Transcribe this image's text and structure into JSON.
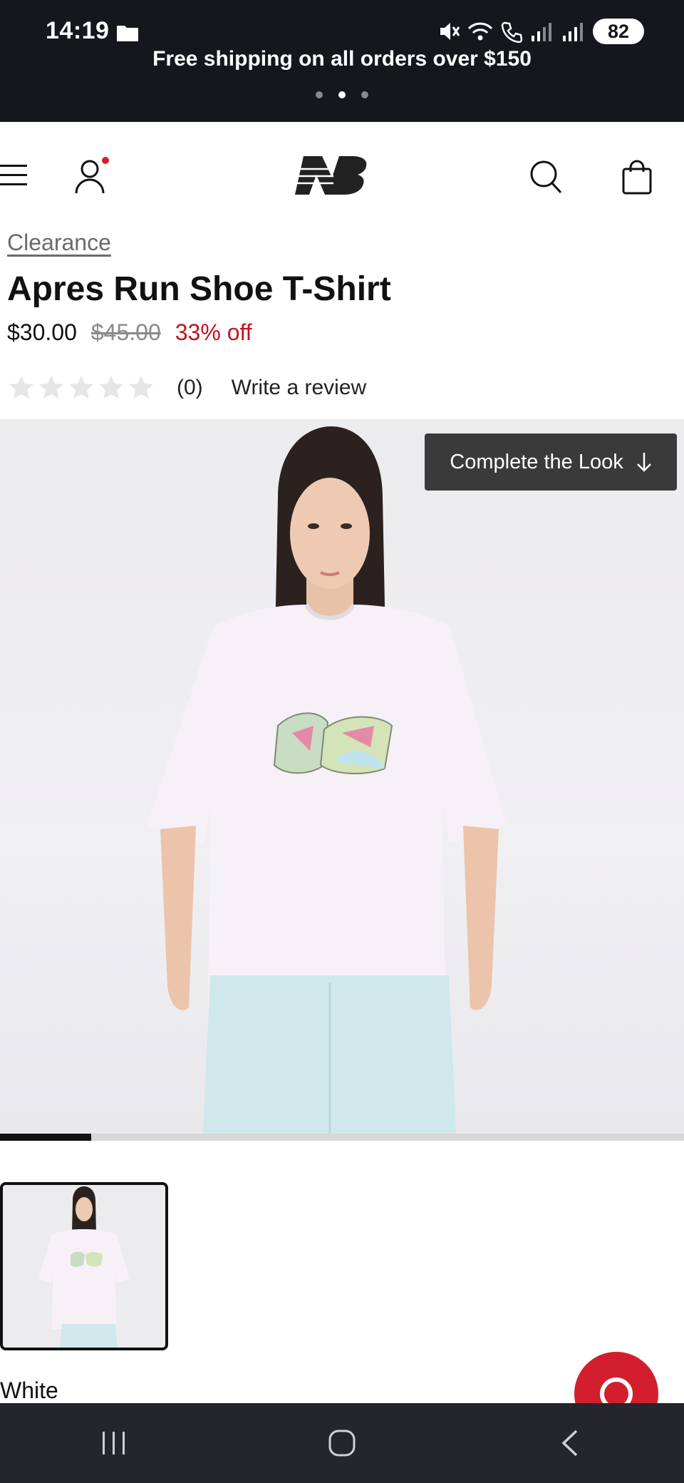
{
  "status_bar": {
    "time": "14:19",
    "battery": "82"
  },
  "promo": {
    "text": "Free shipping on all orders over $150",
    "slides": 3,
    "active_slide": 2
  },
  "header": {
    "logo_alt": "New Balance"
  },
  "product": {
    "breadcrumb": "Clearance",
    "title": "Apres Run Shoe T-Shirt",
    "price_now": "$30.00",
    "price_was": "$45.00",
    "discount": "33% off",
    "rating_stars": 0,
    "review_count": "(0)",
    "write_review": "Write a review"
  },
  "gallery": {
    "complete_look_label": "Complete the Look",
    "progress_fraction": 0.133
  },
  "selected_color": "White",
  "colors": {
    "accent_red": "#c2141f",
    "chat_red": "#d31f2d",
    "dark": "#15171d"
  },
  "icons": [
    "folder-icon",
    "mute-icon",
    "wifi-icon",
    "call-icon",
    "signal-icon",
    "hamburger-icon",
    "account-icon",
    "search-icon",
    "bag-icon",
    "arrow-down-icon",
    "chat-icon",
    "recents-icon",
    "home-icon",
    "back-icon"
  ]
}
